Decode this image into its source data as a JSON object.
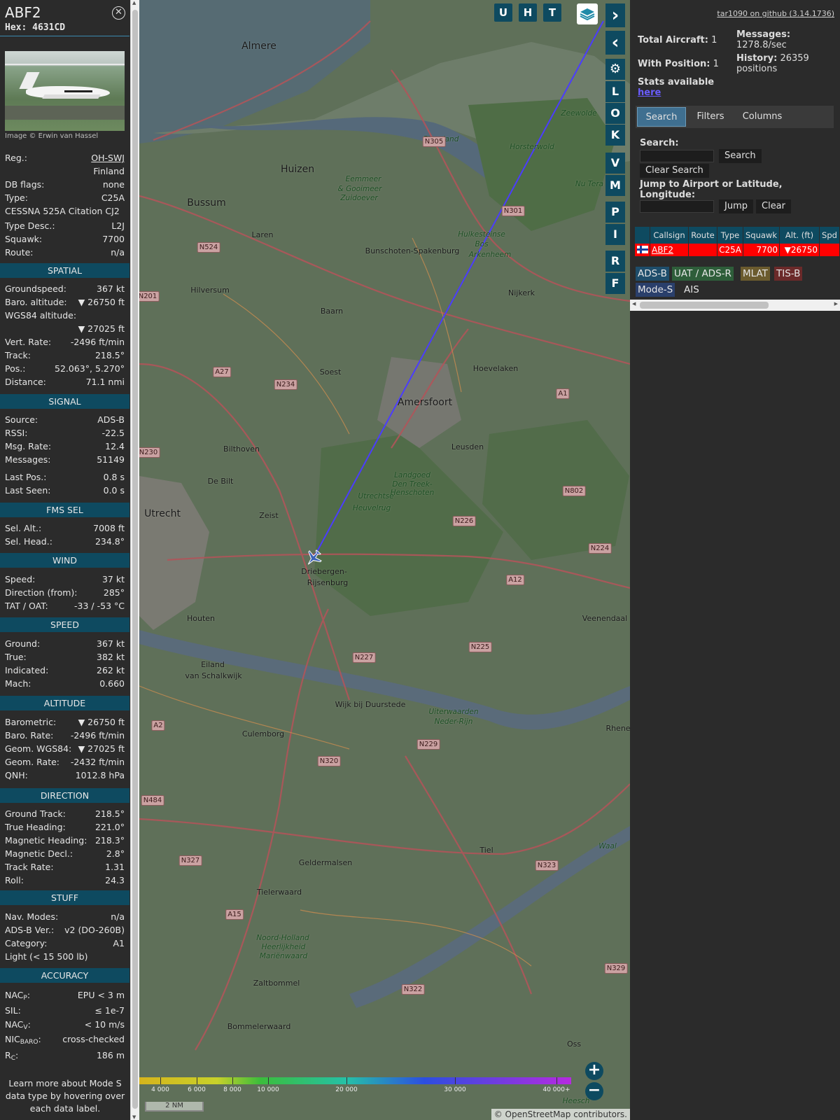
{
  "sidebar": {
    "callsign": "ABF2",
    "hex": "Hex: 4631CD",
    "image_credit": "Image © Erwin van Hassel",
    "header_rows": [
      {
        "label": "Reg.:",
        "value": "OH-SWJ"
      },
      {
        "label": "",
        "value": "Finland"
      },
      {
        "label": "DB flags:",
        "value": "none"
      },
      {
        "label": "Type:",
        "value": "C25A"
      },
      {
        "label": "CESSNA 525A Citation CJ2",
        "value": ""
      },
      {
        "label": "Type Desc.:",
        "value": "L2J"
      },
      {
        "label": "Squawk:",
        "value": "7700"
      },
      {
        "label": "Route:",
        "value": "n/a"
      }
    ],
    "sections": [
      {
        "title": "SPATIAL",
        "rows": [
          {
            "label": "Groundspeed:",
            "value": "367 kt"
          },
          {
            "label": "Baro. altitude:",
            "value": "▼ 26750 ft"
          },
          {
            "label": "WGS84 altitude:",
            "value": ""
          },
          {
            "label": "",
            "value": "▼ 27025 ft"
          },
          {
            "label": "Vert. Rate:",
            "value": "-2496 ft/min"
          },
          {
            "label": "Track:",
            "value": "218.5°"
          },
          {
            "label": "Pos.:",
            "value": "52.063°, 5.270°"
          },
          {
            "label": "Distance:",
            "value": "71.1 nmi"
          }
        ]
      },
      {
        "title": "SIGNAL",
        "rows": [
          {
            "label": "Source:",
            "value": "ADS-B"
          },
          {
            "label": "RSSI:",
            "value": "-22.5"
          },
          {
            "label": "Msg. Rate:",
            "value": "12.4"
          },
          {
            "label": "Messages:",
            "value": "51149"
          },
          {
            "label": "Last Pos.:",
            "value": "0.8 s"
          },
          {
            "label": "Last Seen:",
            "value": "0.0 s"
          }
        ]
      },
      {
        "title": "FMS SEL",
        "rows": [
          {
            "label": "Sel. Alt.:",
            "value": "7008 ft"
          },
          {
            "label": "Sel. Head.:",
            "value": "234.8°"
          }
        ]
      },
      {
        "title": "WIND",
        "rows": [
          {
            "label": "Speed:",
            "value": "37 kt"
          },
          {
            "label": "Direction (from):",
            "value": "285°"
          },
          {
            "label": "TAT / OAT:",
            "value": "-33 / -53 °C"
          }
        ]
      },
      {
        "title": "SPEED",
        "rows": [
          {
            "label": "Ground:",
            "value": "367 kt"
          },
          {
            "label": "True:",
            "value": "382 kt"
          },
          {
            "label": "Indicated:",
            "value": "262 kt"
          },
          {
            "label": "Mach:",
            "value": "0.660"
          }
        ]
      },
      {
        "title": "ALTITUDE",
        "rows": [
          {
            "label": "Barometric:",
            "value": "▼ 26750 ft"
          },
          {
            "label": "Baro. Rate:",
            "value": "-2496 ft/min"
          },
          {
            "label": "Geom. WGS84:",
            "value": "▼ 27025 ft"
          },
          {
            "label": "Geom. Rate:",
            "value": "-2432 ft/min"
          },
          {
            "label": "QNH:",
            "value": "1012.8 hPa"
          }
        ]
      },
      {
        "title": "DIRECTION",
        "rows": [
          {
            "label": "Ground Track:",
            "value": "218.5°"
          },
          {
            "label": "True Heading:",
            "value": "221.0°"
          },
          {
            "label": "Magnetic Heading:",
            "value": "218.3°"
          },
          {
            "label": "Magnetic Decl.:",
            "value": "2.8°"
          },
          {
            "label": "Track Rate:",
            "value": "1.31"
          },
          {
            "label": "Roll:",
            "value": "24.3"
          }
        ]
      },
      {
        "title": "STUFF",
        "rows": [
          {
            "label": "Nav. Modes:",
            "value": "n/a"
          },
          {
            "label": "ADS-B Ver.:",
            "value": "v2 (DO-260B)"
          },
          {
            "label": "Category:",
            "value": "A1"
          },
          {
            "label": "Light (< 15 500 lb)",
            "value": ""
          }
        ]
      }
    ],
    "accuracy_title": "ACCURACY",
    "accuracy": {
      "nacp_value": "EPU < 3 m",
      "sil_label": "SIL:",
      "sil_value": "≤ 1e-7",
      "nacv_value": "< 10 m/s",
      "nicbaro_value": "cross-checked",
      "rc_value": "186 m"
    },
    "learn_more": "Learn more about Mode S data type by hovering over each data label."
  },
  "map": {
    "places": [
      "Almere",
      "Huizen",
      "Bussum",
      "Laren",
      "Hilversum",
      "Baarn",
      "Soest",
      "Bunschoten-Spakenburg",
      "Nijkerk",
      "Hoevelaken",
      "Amersfoort",
      "Leusden",
      "Bilthoven",
      "De Bilt",
      "Zeist",
      "Utrecht",
      "Driebergen-",
      "Rijsenburg",
      "Houten",
      "Eiland",
      "van Schalkwijk",
      "Wijk bij Duurstede",
      "Culemborg",
      "Geldermalsen",
      "Tiel",
      "Tielerwaard",
      "Zaltbommel",
      "Bommelerwaard",
      "Veenendaal",
      "Rhene",
      "Oss",
      "Heesch",
      "Zeewolde",
      "Horsterwold",
      "Flevoland",
      "Utrechtse",
      "Heuvelrug",
      "Eemmeer",
      "& Gooimeer",
      "Zuidoever",
      "Arkenheem",
      "Hulkesteinse",
      "Bos",
      "Noord-Holland",
      "Landgoed",
      "Den Treek-",
      "Henschoten",
      "Uiterwaarden",
      "Neder-Rijn",
      "Heerlijkheid",
      "Mariënwaard",
      "Waal",
      "Nu Tera"
    ],
    "roads": [
      "N305",
      "N301",
      "N524",
      "N201",
      "A27",
      "N234",
      "A1",
      "N230",
      "N802",
      "N226",
      "N224",
      "A12",
      "N227",
      "N225",
      "A2",
      "N229",
      "N320",
      "N484",
      "N327",
      "N323",
      "A15",
      "N322",
      "N329"
    ],
    "buttons": [
      "U",
      "H",
      "T"
    ],
    "side_buttons": [
      "L",
      "O",
      "K",
      "V",
      "M",
      "P",
      "I",
      "R",
      "F"
    ],
    "altitude_scale": [
      "4 000",
      "6 000",
      "8 000",
      "10 000",
      "20 000",
      "30 000",
      "40 000+"
    ],
    "scale_label": "2 NM",
    "attribution": "© OpenStreetMap contributors.",
    "track_color": "#4b3cff"
  },
  "panel": {
    "github_link": "tar1090 on github (3.14.1736)",
    "total_aircraft_label": "Total Aircraft:",
    "total_aircraft": "1",
    "with_position_label": "With Position:",
    "with_position": "1",
    "messages_label": "Messages:",
    "messages_rate": "1278.8/sec",
    "history_label": "History:",
    "history_value": "26359",
    "history_unit": "positions",
    "stats_text": "Stats available",
    "stats_link": "here",
    "tabs": [
      "Search",
      "Filters",
      "Columns"
    ],
    "search_label": "Search:",
    "search_button": "Search",
    "clear_search_button": "Clear Search",
    "jump_label": "Jump to Airport or Latitude, Longitude:",
    "jump_button": "Jump",
    "clear_button": "Clear",
    "table_headers": [
      "",
      "Callsign",
      "Route",
      "Type",
      "Squawk",
      "Alt. (ft)",
      "Spd"
    ],
    "table_row": {
      "callsign": "ABF2",
      "route": "",
      "type": "C25A",
      "squawk": "7700",
      "alt": "▼26750",
      "spd": ""
    },
    "source_badges": [
      {
        "label": "ADS-B",
        "color": "#1e4d6b"
      },
      {
        "label": "UAT / ADS-R",
        "color": "#2e5e3a"
      },
      {
        "label": "MLAT",
        "color": "#6b5b2e"
      },
      {
        "label": "TIS-B",
        "color": "#6b2a2a"
      },
      {
        "label": "Mode-S",
        "color": "#2a3f6b"
      },
      {
        "label": "AIS",
        "color": "#2b2b2b"
      }
    ]
  }
}
